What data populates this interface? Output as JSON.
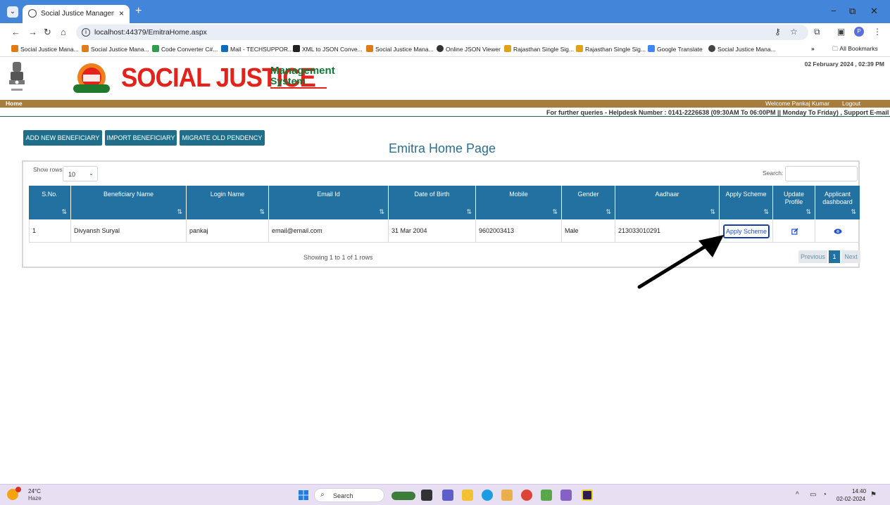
{
  "browser": {
    "tab_title": "Social Justice Management Syst",
    "tab_close": "×",
    "new_tab": "+",
    "url": "localhost:44379/EmitraHome.aspx",
    "window_min": "−",
    "window_restore": "⧉",
    "window_close": "✕",
    "bookmarks": [
      {
        "label": "Social Justice Mana...",
        "color": "#e07b1a"
      },
      {
        "label": "Social Justice Mana...",
        "color": "#e07b1a"
      },
      {
        "label": "Code Converter C#...",
        "color": "#2e9e4b"
      },
      {
        "label": "Mail - TECHSUPPOR...",
        "color": "#0f6cbd"
      },
      {
        "label": "XML to JSON Conve...",
        "color": "#222222"
      },
      {
        "label": "Social Justice Mana...",
        "color": "#e07b1a"
      },
      {
        "label": "Online JSON Viewer",
        "color": "#333333"
      },
      {
        "label": "Rajasthan Single Sig...",
        "color": "#e0a21a"
      },
      {
        "label": "Rajasthan Single Sig...",
        "color": "#e0a21a"
      },
      {
        "label": "Google Translate",
        "color": "#4285f4"
      },
      {
        "label": "Social Justice Mana...",
        "color": "#444444"
      }
    ],
    "bookmarks_more": "»",
    "all_bookmarks": "All Bookmarks",
    "profile_initial": "P"
  },
  "header": {
    "brand_main": "SOCIAL JUSTICE",
    "brand_management": "Management",
    "brand_system": "System",
    "datetime": "02 February 2024 , 02:39 PM",
    "menu_home": "Home",
    "welcome": "Welcome Pankaj Kumar",
    "logout": "Logout",
    "helpdesk": "For further queries - Helpdesk Number : 0141-2226638 (09:30AM To 06:00PM || Monday To Friday) , Support E-mail"
  },
  "actions": {
    "add_new": "ADD NEW BENEFICIARY",
    "import": "IMPORT BENEFICIARY",
    "migrate": "MIGRATE OLD PENDENCY"
  },
  "page_title": "Emitra Home Page",
  "grid": {
    "show_rows_label": "Show rows",
    "show_rows_value": "10",
    "search_label": "Search:",
    "columns": [
      "S.No.",
      "Beneficiary Name",
      "Login Name",
      "Email Id",
      "Date of Birth",
      "Mobile",
      "Gender",
      "Aadhaar",
      "Apply Scheme",
      "Update Profile",
      "Applicant dashboard"
    ],
    "sort_glyph": "⇅",
    "rows": [
      {
        "sno": "1",
        "name": "Divyansh Suryal",
        "login": "pankaj",
        "email": "email@email.com",
        "dob": "31 Mar 2004",
        "mobile": "9602003413",
        "gender": "Male",
        "aadhaar": "213033010291",
        "apply_label": "Apply Scheme"
      }
    ],
    "showing": "Showing 1 to 1 of 1 rows",
    "pagination": {
      "previous": "Previous",
      "current": "1",
      "next": "Next"
    }
  },
  "taskbar": {
    "temperature": "24°C",
    "condition": "Haze",
    "search_placeholder": "Search",
    "time": "14:40",
    "date": "02-02-2024"
  },
  "colors": {
    "header_blue": "#2271a1",
    "action_button": "#1f6f8b",
    "brand_red": "#e3231b",
    "brand_green": "#0b7a35",
    "menubar": "#a77d3e"
  }
}
